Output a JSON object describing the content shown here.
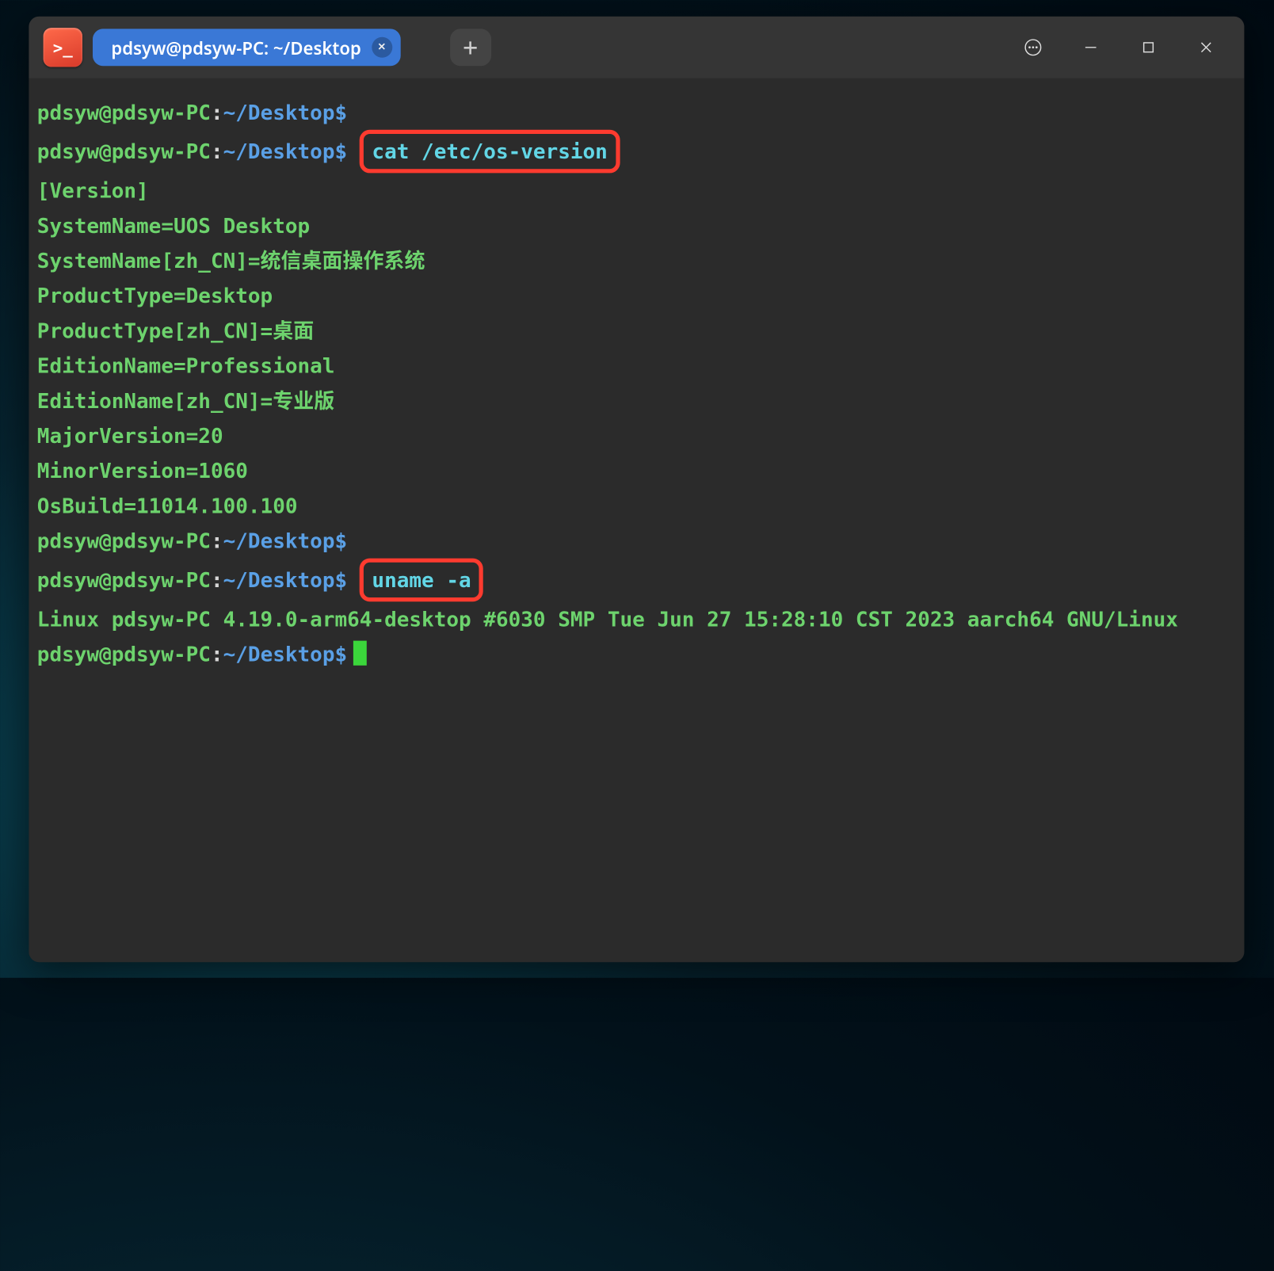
{
  "tab": {
    "label": "pdsyw@pdsyw-PC: ~/Desktop"
  },
  "app_icon_glyph": ">_",
  "prompt": {
    "user": "pdsyw@pdsyw-PC",
    "path": "~/Desktop",
    "sigil": "$"
  },
  "lines": [
    {
      "type": "prompt",
      "cmd": ""
    },
    {
      "type": "prompt",
      "cmd": "cat /etc/os-version",
      "highlight": true
    },
    {
      "type": "out",
      "text": "[Version]"
    },
    {
      "type": "out",
      "text": "SystemName=UOS Desktop"
    },
    {
      "type": "out",
      "text": "SystemName[zh_CN]=统信桌面操作系统"
    },
    {
      "type": "out",
      "text": "ProductType=Desktop"
    },
    {
      "type": "out",
      "text": "ProductType[zh_CN]=桌面"
    },
    {
      "type": "out",
      "text": "EditionName=Professional"
    },
    {
      "type": "out",
      "text": "EditionName[zh_CN]=专业版"
    },
    {
      "type": "out",
      "text": "MajorVersion=20"
    },
    {
      "type": "out",
      "text": "MinorVersion=1060"
    },
    {
      "type": "out",
      "text": "OsBuild=11014.100.100"
    },
    {
      "type": "prompt",
      "cmd": ""
    },
    {
      "type": "prompt",
      "cmd": "uname -a",
      "highlight": true
    },
    {
      "type": "out",
      "text": "Linux pdsyw-PC 4.19.0-arm64-desktop #6030 SMP Tue Jun 27 15:28:10 CST 2023 aarch64 GNU/Linux"
    },
    {
      "type": "prompt",
      "cmd": "",
      "cursor": true
    }
  ]
}
